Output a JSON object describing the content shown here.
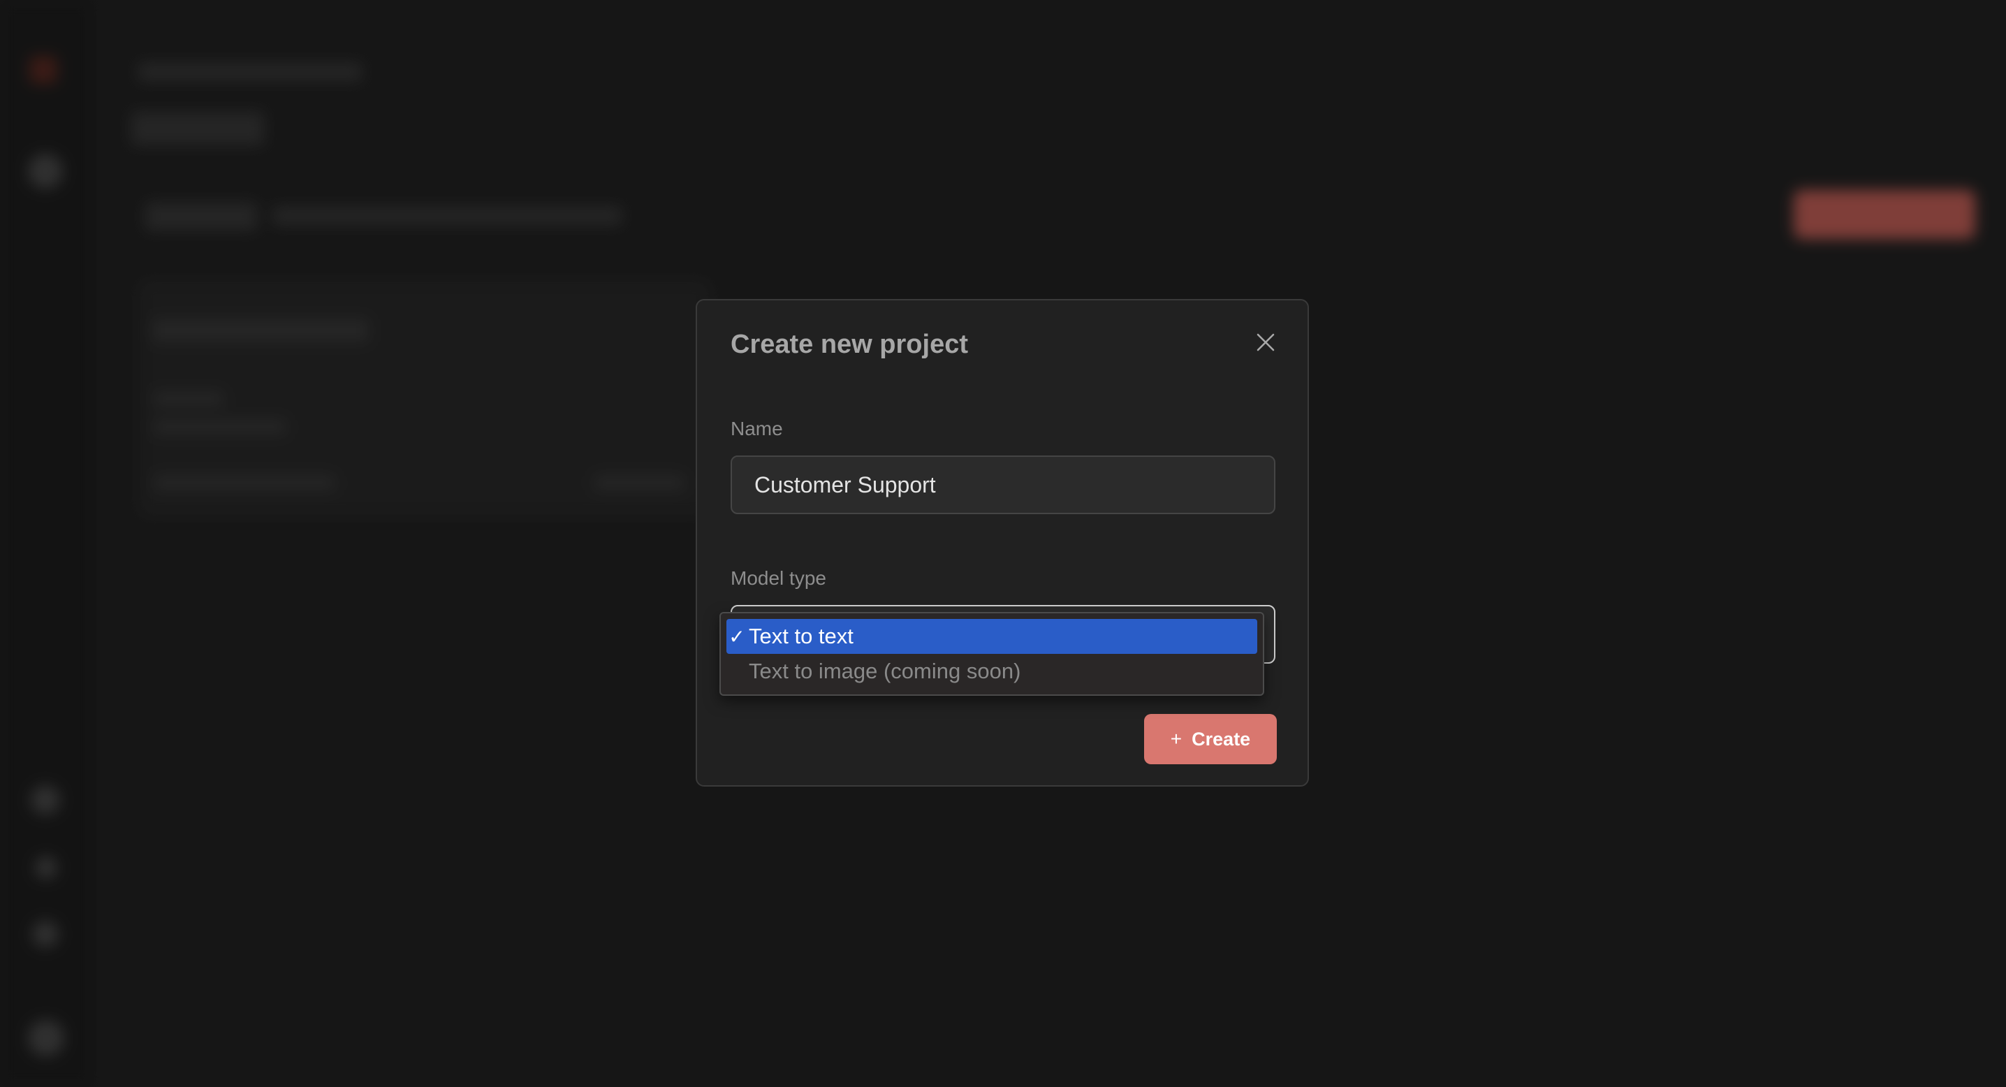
{
  "modal": {
    "title": "Create new project",
    "name_label": "Name",
    "name_value": "Customer Support",
    "model_type_label": "Model type",
    "create_label": "Create"
  },
  "dropdown": {
    "options": [
      {
        "check": "✓",
        "label": "Text to text",
        "selected": true,
        "disabled": false
      },
      {
        "check": "",
        "label": "Text to image (coming soon)",
        "selected": false,
        "disabled": true
      }
    ]
  },
  "colors": {
    "accent": "#d9776f",
    "selected_option": "#2a5dc8",
    "modal_bg": "#212121",
    "page_bg": "#232323"
  },
  "icons": {
    "close": "close-icon",
    "plus": "plus-icon",
    "check": "check-icon"
  }
}
